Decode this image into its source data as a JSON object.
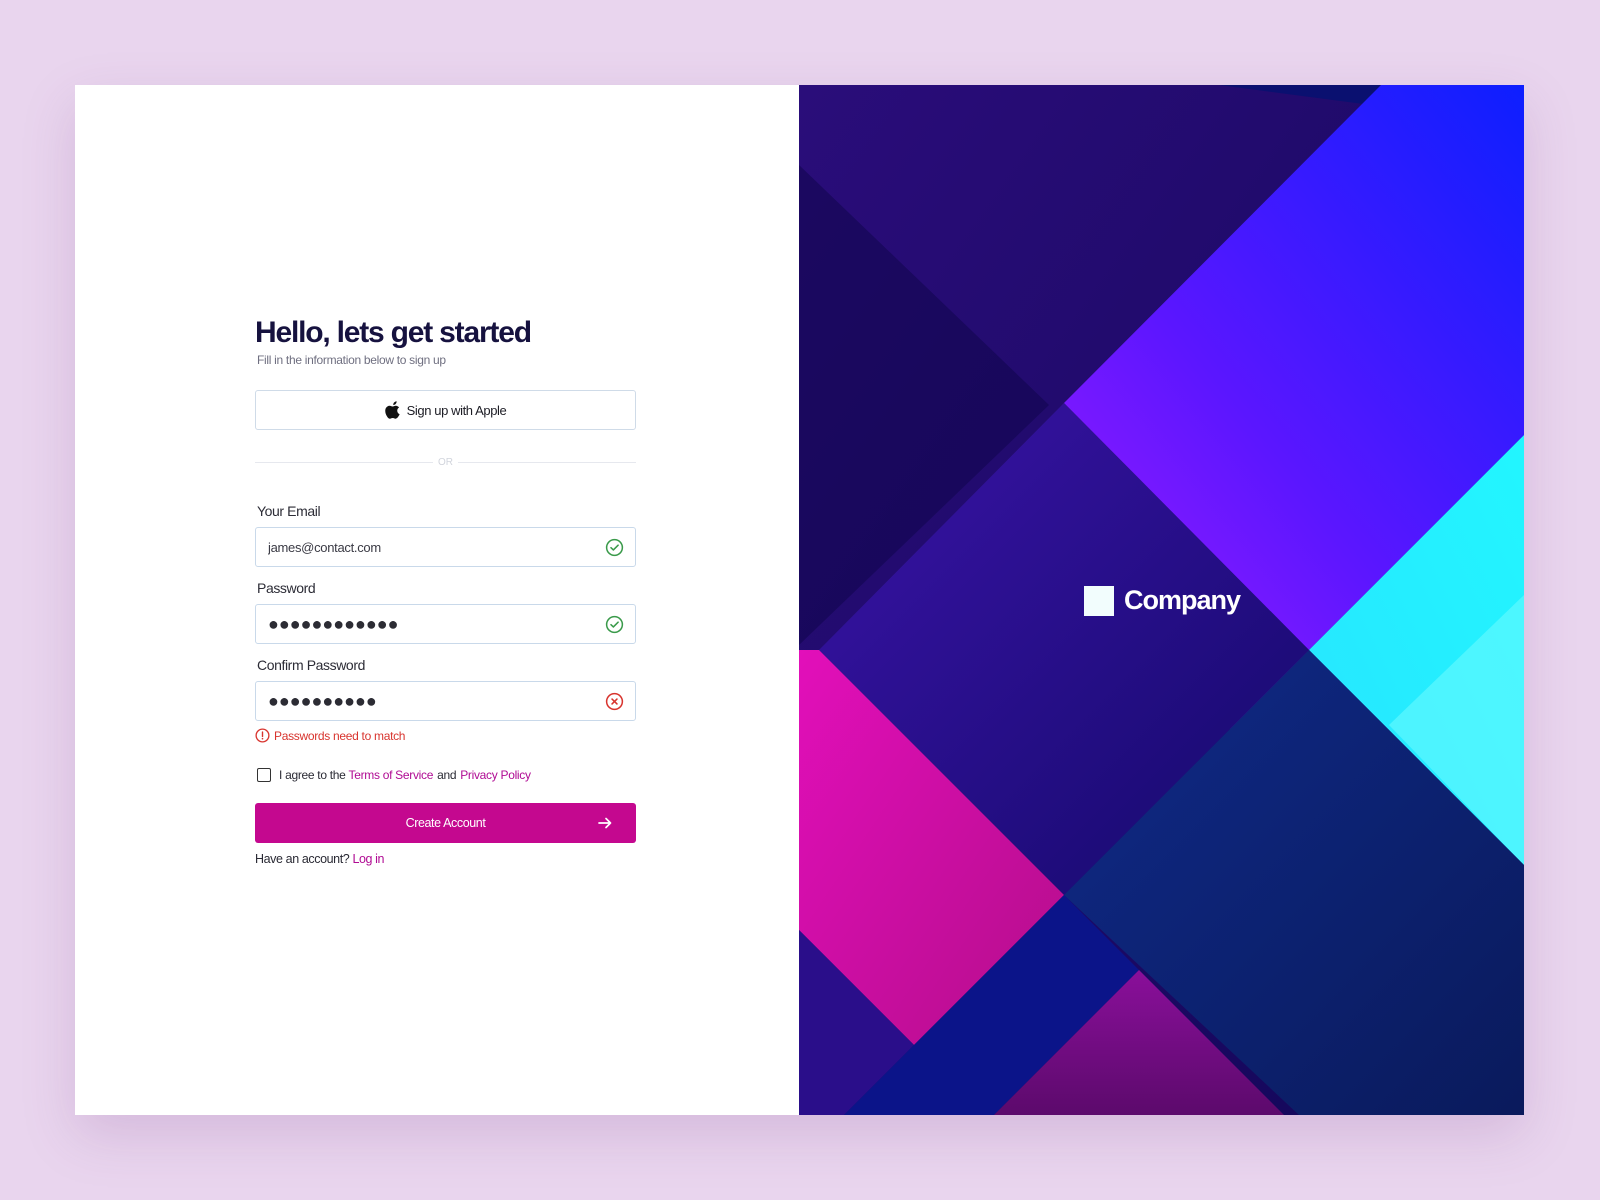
{
  "page": {
    "title": "Hello, lets get started",
    "subtitle": "Fill in the information below  to sign up"
  },
  "apple_button": {
    "label": "Sign up with Apple"
  },
  "divider": {
    "text": "OR"
  },
  "fields": {
    "email": {
      "label": "Your Email",
      "value": "james@contact.com",
      "status": "valid"
    },
    "password": {
      "label": "Password",
      "value": "●●●●●●●●●●●●",
      "status": "valid"
    },
    "confirm_password": {
      "label": "Confirm Password",
      "value": "●●●●●●●●●●",
      "status": "invalid"
    }
  },
  "error": {
    "text": "Passwords need to match"
  },
  "agreement": {
    "prefix": "I agree to the",
    "terms": "Terms of Service",
    "and": "and",
    "privacy": "Privacy Policy",
    "checked": false
  },
  "create_button": {
    "label": "Create Account"
  },
  "login_prompt": {
    "text": "Have an account?",
    "link": "Log in"
  },
  "brand": {
    "name": "Company"
  },
  "colors": {
    "accent": "#c4088f",
    "valid": "#3a9a4a",
    "error": "#d8342e",
    "heading": "#16123f",
    "page_bg": "#e9d5ee"
  },
  "icons": [
    "apple-icon",
    "check-circle-icon",
    "x-circle-icon",
    "alert-circle-icon",
    "arrow-right-icon"
  ]
}
